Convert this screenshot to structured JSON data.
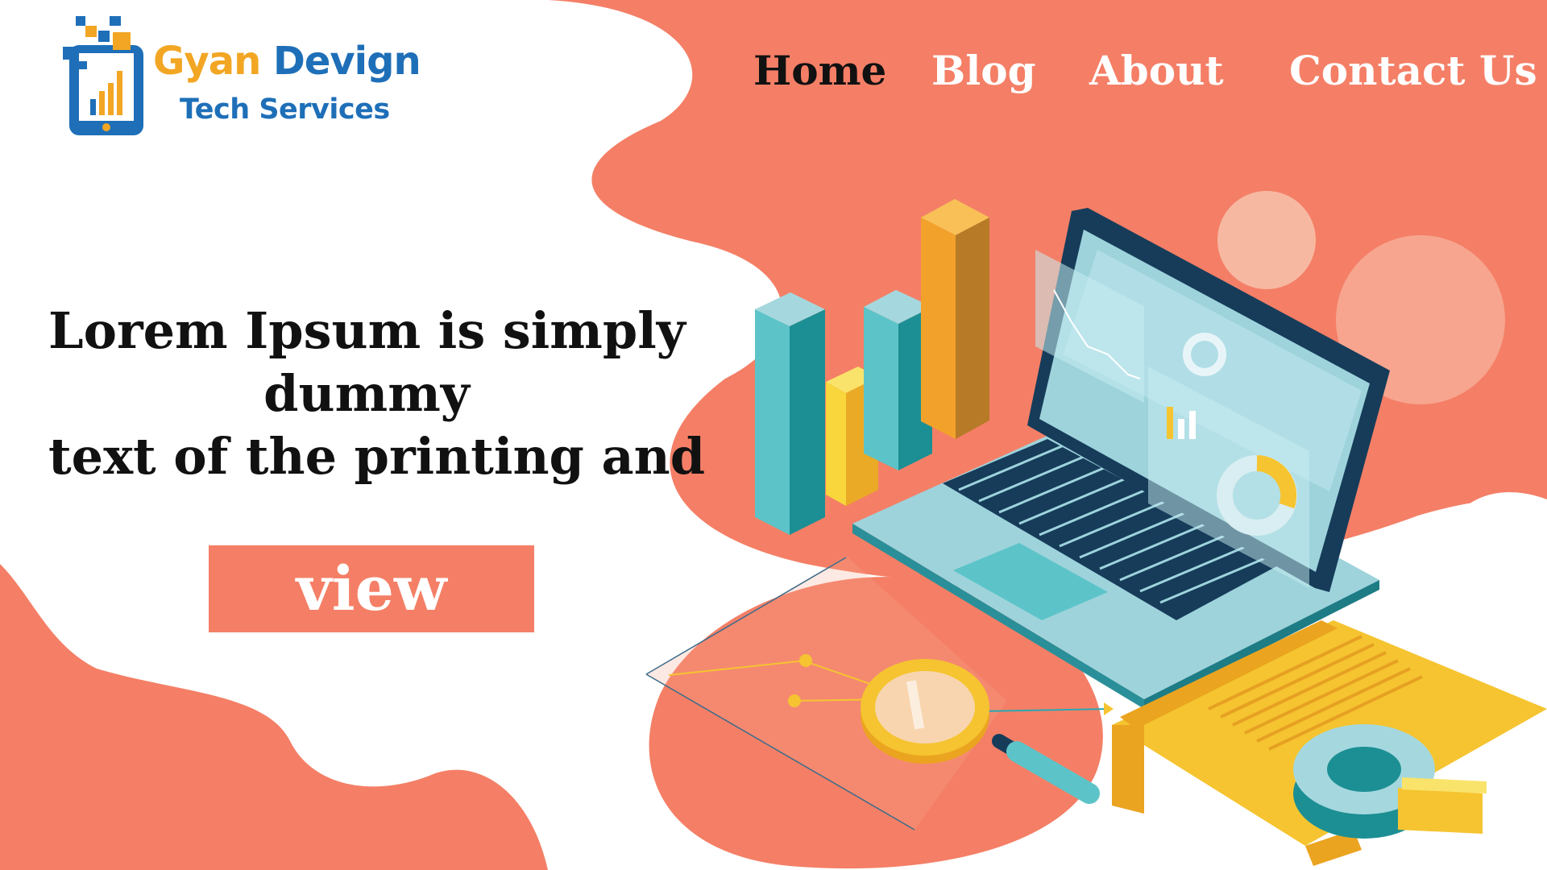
{
  "brand": {
    "name_part1": "Gyan",
    "name_part2": "Devign",
    "tagline": "Tech Services"
  },
  "nav": {
    "items": [
      {
        "label": "Home",
        "active": true
      },
      {
        "label": "Blog",
        "active": false
      },
      {
        "label": "About",
        "active": false
      },
      {
        "label": "Contact Us",
        "active": false
      }
    ]
  },
  "hero": {
    "title_lines": [
      "Lorem Ipsum is simply",
      "dummy",
      "text of the printing and"
    ],
    "cta_label": "view"
  },
  "colors": {
    "accent": "#F47F66",
    "teal": "#1C8F94",
    "yellow": "#F5C430",
    "brand_blue": "#1E6FB8",
    "brand_orange": "#F2A623"
  }
}
